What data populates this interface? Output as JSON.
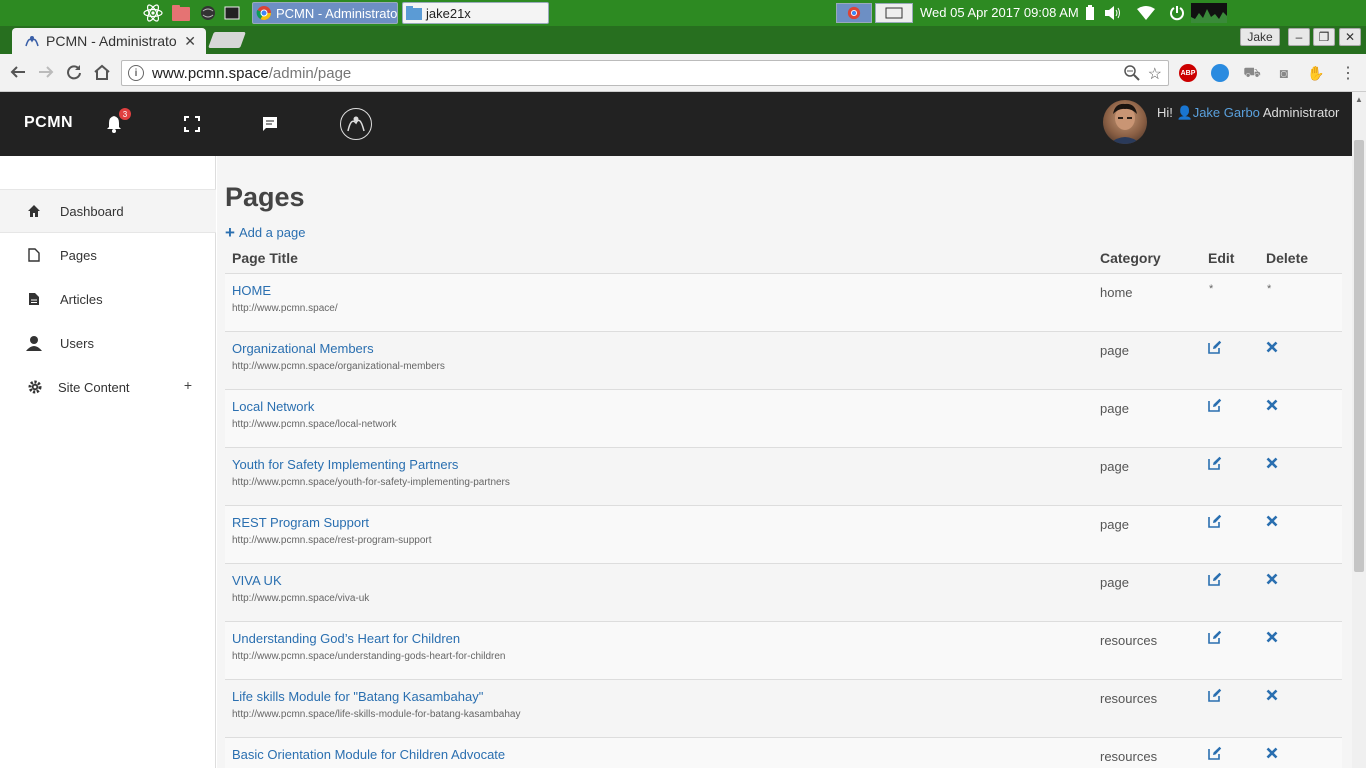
{
  "os": {
    "tasks": [
      {
        "label": "PCMN - Administrato",
        "active": true
      },
      {
        "label": "jake21x",
        "active": false
      }
    ],
    "clock": "Wed 05 Apr 2017  09:08 AM"
  },
  "browser": {
    "tab_title": "PCMN - Administrato",
    "profile": "Jake",
    "url_host": "www.pcmn.space",
    "url_path": "/admin/page",
    "ext_abp": "ABP"
  },
  "header": {
    "brand": "PCMN",
    "notification_count": "3",
    "greeting": "Hi!",
    "user_name": "Jake Garbo",
    "user_role": "Administrator"
  },
  "sidebar": {
    "items": [
      {
        "label": "Dashboard",
        "icon": "home-icon",
        "active": true
      },
      {
        "label": "Pages",
        "icon": "file-icon"
      },
      {
        "label": "Articles",
        "icon": "document-icon"
      },
      {
        "label": "Users",
        "icon": "user-icon"
      },
      {
        "label": "Site Content",
        "icon": "gear-icon",
        "expandable": true
      }
    ],
    "expand_symbol": "+"
  },
  "main": {
    "title": "Pages",
    "add_label": "Add a page",
    "columns": {
      "title": "Page Title",
      "category": "Category",
      "edit": "Edit",
      "delete": "Delete"
    },
    "rows": [
      {
        "title": "HOME",
        "url": "http://www.pcmn.space/",
        "category": "home",
        "locked": true
      },
      {
        "title": "Organizational Members",
        "url": "http://www.pcmn.space/organizational-members",
        "category": "page"
      },
      {
        "title": "Local Network",
        "url": "http://www.pcmn.space/local-network",
        "category": "page"
      },
      {
        "title": "Youth for Safety Implementing Partners",
        "url": "http://www.pcmn.space/youth-for-safety-implementing-partners",
        "category": "page"
      },
      {
        "title": "REST Program Support",
        "url": "http://www.pcmn.space/rest-program-support",
        "category": "page"
      },
      {
        "title": "VIVA UK",
        "url": "http://www.pcmn.space/viva-uk",
        "category": "page"
      },
      {
        "title": "Understanding God’s Heart for Children",
        "url": "http://www.pcmn.space/understanding-gods-heart-for-children",
        "category": "resources"
      },
      {
        "title": "Life skills Module for \"Batang Kasambahay\"",
        "url": "http://www.pcmn.space/life-skills-module-for-batang-kasambahay",
        "category": "resources"
      },
      {
        "title": "Basic Orientation Module for Children Advocate",
        "url": "",
        "category": "resources"
      }
    ],
    "locked_symbol": "*"
  },
  "colors": {
    "link": "#2a6fb0",
    "header_bg": "#222222",
    "taskbar": "#2d8a22"
  }
}
